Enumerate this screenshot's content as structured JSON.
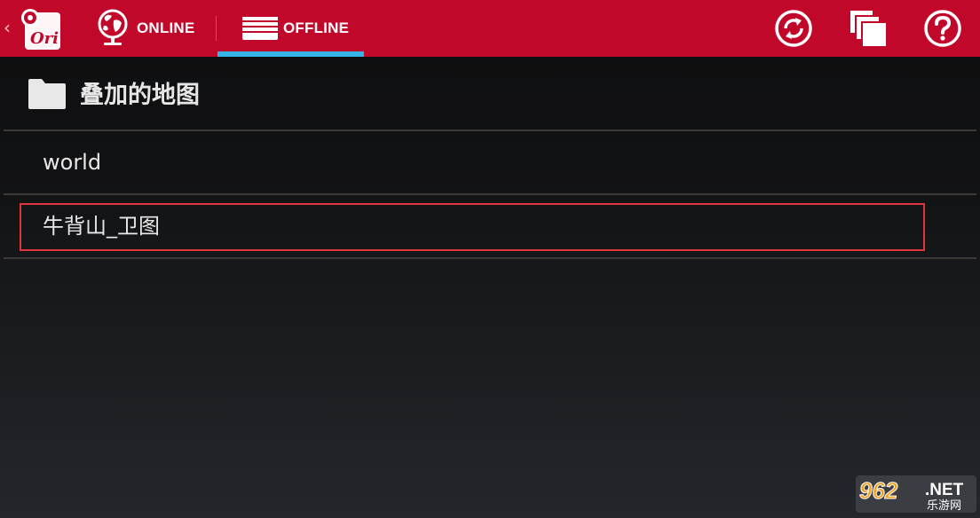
{
  "actionbar": {
    "background": "#c2082a",
    "back_chevron": "‹",
    "logo_text": "Ori",
    "tabs": [
      {
        "label": "ONLINE",
        "icon": "globe-icon",
        "selected": false
      },
      {
        "label": "OFFLINE",
        "icon": "offline-stack-icon",
        "selected": true
      }
    ],
    "indicator_color": "#33b5e5",
    "actions": [
      {
        "icon": "sync-icon"
      },
      {
        "icon": "layers-icon"
      },
      {
        "icon": "help-icon"
      }
    ]
  },
  "section": {
    "title": "叠加的地图",
    "icon": "folder-icon"
  },
  "list": {
    "items": [
      {
        "label": "world"
      },
      {
        "label": "牛背山_卫图",
        "highlighted": true
      }
    ],
    "highlight_color": "#e0343b"
  },
  "watermark": {
    "number": "962",
    "suffix": ".NET",
    "subtitle": "乐游网"
  }
}
